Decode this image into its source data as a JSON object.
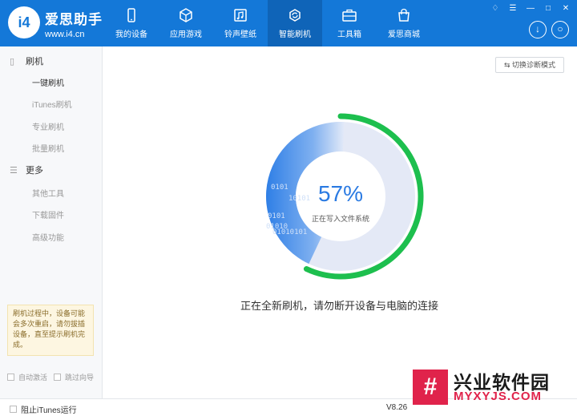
{
  "brand": {
    "logo_text": "i4",
    "name": "爱思助手",
    "url": "www.i4.cn"
  },
  "nav": [
    {
      "label": "我的设备",
      "icon": "phone-icon"
    },
    {
      "label": "应用游戏",
      "icon": "cube-icon"
    },
    {
      "label": "铃声壁纸",
      "icon": "music-folder-icon"
    },
    {
      "label": "智能刷机",
      "icon": "refresh-gear-icon",
      "active": true
    },
    {
      "label": "工具箱",
      "icon": "toolbox-icon"
    },
    {
      "label": "爱思商城",
      "icon": "shopping-bag-icon"
    }
  ],
  "window_controls": [
    "♢",
    "☰",
    "—",
    "□",
    "✕"
  ],
  "header_buttons": {
    "download": "↓",
    "user": "○"
  },
  "sidebar": {
    "section1": "刷机",
    "items1": [
      "一键刷机",
      "iTunes刷机",
      "专业刷机",
      "批量刷机"
    ],
    "section2": "更多",
    "items2": [
      "其他工具",
      "下载固件",
      "高级功能"
    ],
    "tip": "刷机过程中，设备可能会多次重启，请勿拔插设备，直至提示刷机完成。",
    "auto_activate": "自动激活",
    "skip_guide": "跳过向导"
  },
  "main": {
    "diag_button": "切换诊断模式",
    "progress_percent": 57,
    "progress_label": "57%",
    "progress_sub": "正在写入文件系统",
    "binary_text": [
      "0101",
      "0101",
      "10101",
      "01010101",
      "01010"
    ],
    "status": "正在全新刷机，请勿断开设备与电脑的连接"
  },
  "footer": {
    "block_itunes": "阻止iTunes运行",
    "version": "V8.26"
  },
  "watermark": {
    "mark": "#",
    "title": "兴业软件园",
    "url": "MYXYJS.COM"
  },
  "colors": {
    "header": "#1478d8",
    "progress": "#1dbf4e",
    "accent": "#2a7ae2",
    "watermark": "#e0234b"
  }
}
